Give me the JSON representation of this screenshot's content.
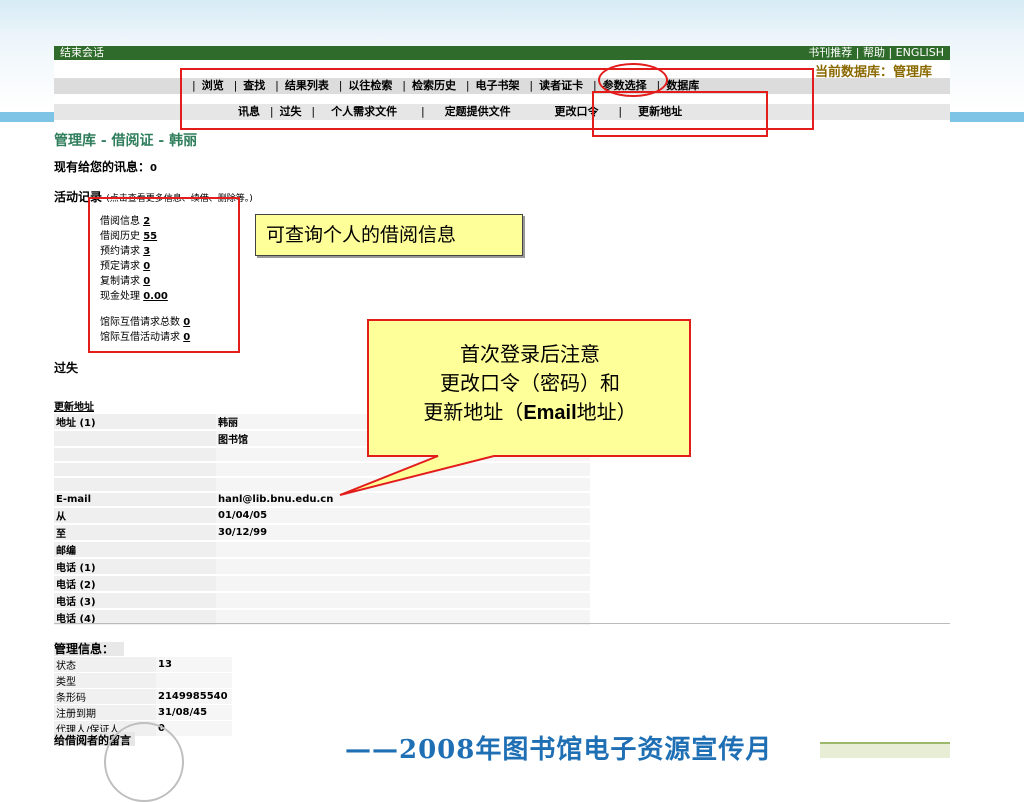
{
  "topbar": {
    "logout": "结束会话",
    "right_links": "书刊推荐 | 帮助 | ENGLISH",
    "current_db": "当前数据库：管理库"
  },
  "nav1": [
    "浏览",
    "查找",
    "结果列表",
    "以往检索",
    "检索历史",
    "电子书架",
    "读者证卡",
    "参数选择",
    "数据库"
  ],
  "nav2": [
    "讯息",
    "过失",
    "个人需求文件",
    "定题提供文件",
    "更改口令",
    "更新地址"
  ],
  "page_title": "管理库 - 借阅证 - 韩丽",
  "messages": {
    "label": "现有给您的讯息：",
    "count": "0"
  },
  "activity": {
    "label": "活动记录",
    "hint": "(点击查看更多信息、续借、删除等。)"
  },
  "stats": [
    {
      "label": "借阅信息",
      "value": "2"
    },
    {
      "label": "借阅历史",
      "value": "55"
    },
    {
      "label": "预约请求",
      "value": "3"
    },
    {
      "label": "预定请求",
      "value": "0"
    },
    {
      "label": "复制请求",
      "value": "0"
    },
    {
      "label": "现金处理",
      "value": "0.00"
    }
  ],
  "ill_stats": [
    {
      "label": "馆际互借请求总数",
      "value": "0"
    },
    {
      "label": "馆际互借活动请求",
      "value": "0"
    }
  ],
  "lost_heading": "过失",
  "address_heading": "更新地址",
  "address_rows": [
    {
      "key": "地址 (1)",
      "value": "韩丽"
    },
    {
      "key": "",
      "value": "图书馆"
    },
    {
      "key": "",
      "value": ""
    },
    {
      "key": "",
      "value": ""
    },
    {
      "key": "",
      "value": ""
    },
    {
      "key": "E-mail",
      "value": "hanl@lib.bnu.edu.cn"
    },
    {
      "key": "从",
      "value": "01/04/05"
    },
    {
      "key": "至",
      "value": "30/12/99"
    },
    {
      "key": "邮编",
      "value": ""
    },
    {
      "key": "电话 (1)",
      "value": ""
    },
    {
      "key": "电话 (2)",
      "value": ""
    },
    {
      "key": "电话 (3)",
      "value": ""
    },
    {
      "key": "电话 (4)",
      "value": ""
    }
  ],
  "management": {
    "heading": "管理信息：",
    "rows": [
      {
        "key": "状态",
        "value": "13"
      },
      {
        "key": "类型",
        "value": ""
      },
      {
        "key": "条形码",
        "value": "2149985540"
      },
      {
        "key": "注册到期",
        "value": "31/08/45"
      },
      {
        "key": "代理人/保证人",
        "value": "0"
      }
    ],
    "message_to_reader": "给借阅者的留言"
  },
  "callouts": {
    "borrow_info": "可查询个人的借阅信息",
    "line1": "首次登录后注意",
    "line2": "更改口令（密码）和",
    "line3_pre": "更新地址（",
    "line3_bold": "Email",
    "line3_post": "地址）"
  },
  "footer": "——2008年图书馆电子资源宣传月",
  "colors": {
    "topbar": "#2f6b2a",
    "highlight": "#e31c1c",
    "callout_fill": "#ffff99",
    "title_green": "#2e7d5b",
    "footer_blue": "#1f6fb4"
  }
}
